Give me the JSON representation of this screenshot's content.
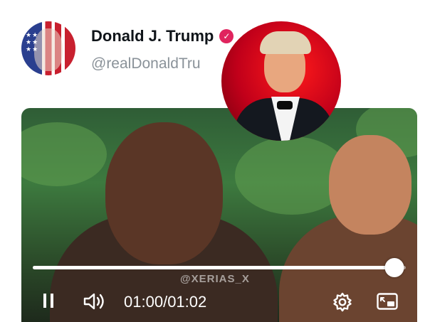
{
  "post": {
    "display_name": "Donald J. Trump",
    "handle": "@realDonaldTru",
    "verified_badge_color": "#e0245e"
  },
  "video": {
    "watermark": "@XERIAS_X",
    "current_time": "01:00",
    "separator": "/",
    "duration": "01:02",
    "progress": 0.97,
    "state": "playing"
  },
  "icons": {
    "pause": "pause-icon",
    "volume": "volume-icon",
    "settings": "gear-icon",
    "pip": "picture-in-picture-icon"
  }
}
